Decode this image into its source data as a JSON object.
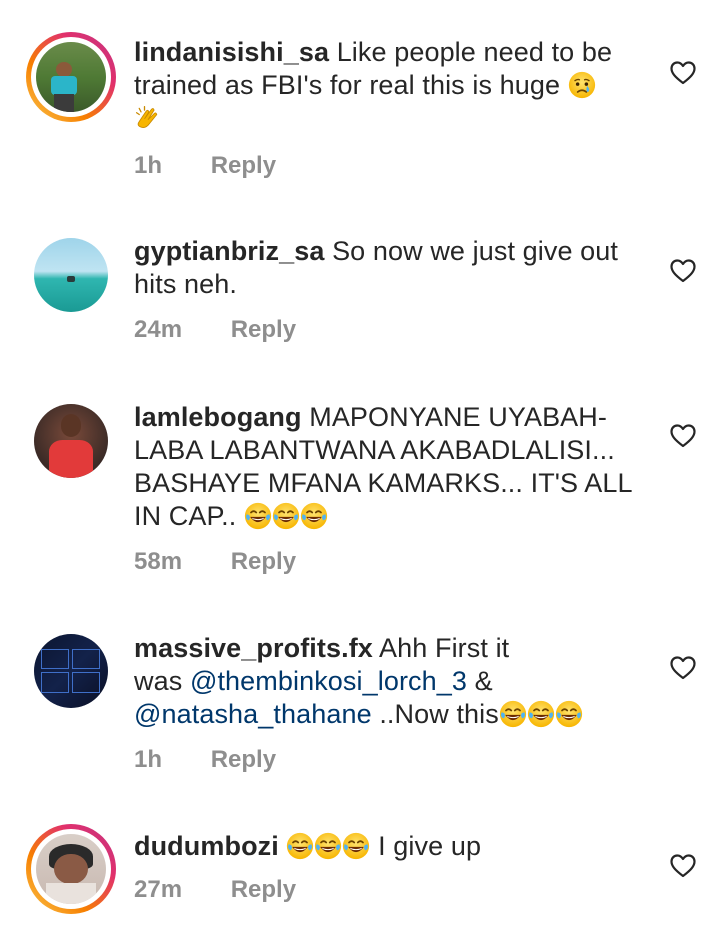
{
  "comments": [
    {
      "username": "lindanisishi_sa",
      "text": "Like people need to be trained as FBI's for real this is huge",
      "time": "1h",
      "reply": "Reply",
      "emojis": [
        "crying-face",
        "clapping-hands"
      ],
      "avatar": "man-standing-outdoors"
    },
    {
      "username": "gyptianbriz_sa",
      "text": "So now we just give out hits neh.",
      "time": "24m",
      "reply": "Reply",
      "avatar": "ocean-horizon"
    },
    {
      "username": "lamlebogang",
      "text_line1": "MAPONYANE UYABAH-",
      "text_line2": "LABA LABANTWANA AKABADLALISI...",
      "text_line3": "BASHAYE MFANA KAMARKS... IT'S ALL",
      "text_line4": "IN CAP..",
      "time": "58m",
      "reply": "Reply",
      "emojis": [
        "tears-of-joy",
        "tears-of-joy",
        "tears-of-joy"
      ],
      "avatar": "man-red-shirt"
    },
    {
      "username": "massive_profits.fx",
      "text_part1": "Ahh First it",
      "text_part2": "was",
      "mention1": "@thembinkosi_lorch_3",
      "text_part3": "&",
      "mention2": "@natasha_thahane",
      "text_part4": "..Now this",
      "time": "1h",
      "reply": "Reply",
      "emojis": [
        "tears-of-joy",
        "tears-of-joy",
        "tears-of-joy"
      ],
      "avatar": "trading-screens"
    },
    {
      "username": "dudumbozi",
      "text": "I give up",
      "time": "27m",
      "reply": "Reply",
      "emojis": [
        "tears-of-joy",
        "tears-of-joy",
        "tears-of-joy"
      ],
      "avatar": "woman-selfie"
    }
  ],
  "colors": {
    "text": "#262626",
    "meta": "#8e8e8e",
    "mention": "#00376b",
    "story_ring": "#e1306c"
  }
}
